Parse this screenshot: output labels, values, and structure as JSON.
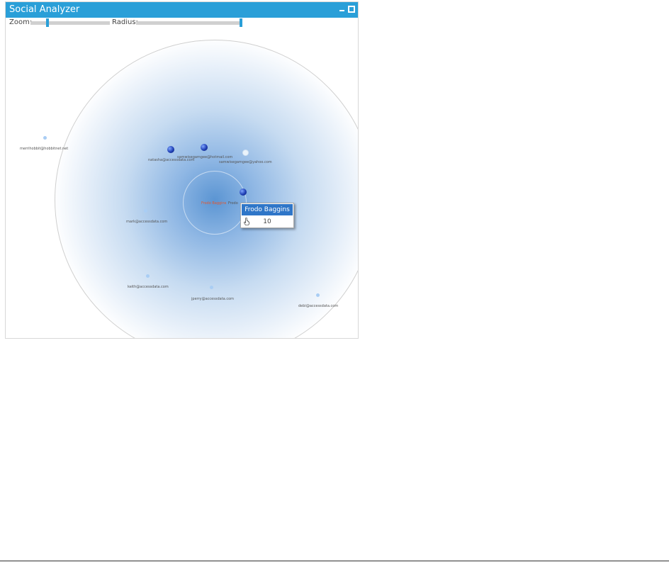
{
  "window": {
    "title": "Social Analyzer"
  },
  "controls": {
    "zoom_label": "Zoom:",
    "radius_label": "Radius:",
    "zoom_value": 0.2,
    "radius_value": 1.0
  },
  "center": {
    "label": "Frodo Baggins",
    "label_suffix": "Frodo"
  },
  "contacts": [
    {
      "label": "merrihobbit@hobbitnet.net"
    },
    {
      "label": "natasha@accessdata.com"
    },
    {
      "label": "samwisegamgee@hotmail.com"
    },
    {
      "label": "samwisegamgee@yahoo.com"
    },
    {
      "label": "mark@accessdata.com"
    },
    {
      "label": "keith@accessdata.com"
    },
    {
      "label": "jperry@accessdata.com"
    },
    {
      "label": "debi@accessdata.com"
    }
  ],
  "tooltip": {
    "name": "Frodo Baggins",
    "value": "10"
  },
  "colors": {
    "accent": "#2a9fd8",
    "tooltip_header": "#2f76c8",
    "center_label": "#e4572e"
  }
}
